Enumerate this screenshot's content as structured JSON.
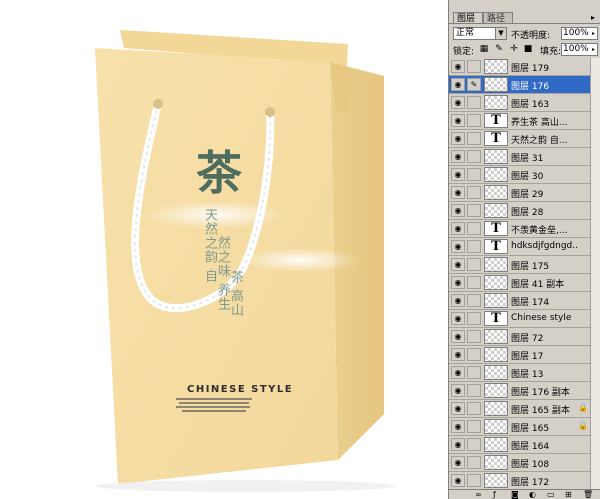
{
  "canvas": {
    "bag_main_character": "茶",
    "bag_vertical_texts": [
      "天然之韵 自",
      "然之味 养生",
      "茶 高山"
    ],
    "brand_text": "CHINESE STYLE"
  },
  "panel": {
    "tabs": [
      {
        "label": "图层",
        "active": true
      },
      {
        "label": "路径",
        "active": false
      }
    ],
    "menu_arrow": "▸",
    "blend_mode": "正常",
    "opacity_label": "不透明度:",
    "opacity_value": "100%",
    "lock_label": "锁定:",
    "fill_label": "填充:",
    "fill_value": "100%",
    "layers": [
      {
        "name": "图层 179",
        "type": "raster",
        "selected": false,
        "locked": false
      },
      {
        "name": "图层 176",
        "type": "raster",
        "selected": true,
        "locked": false
      },
      {
        "name": "图层 163",
        "type": "raster",
        "selected": false,
        "locked": false
      },
      {
        "name": "养生茶 高山...",
        "type": "text",
        "selected": false,
        "locked": false
      },
      {
        "name": "天然之韵 自...",
        "type": "text",
        "selected": false,
        "locked": false
      },
      {
        "name": "图层 31",
        "type": "raster",
        "selected": false,
        "locked": false
      },
      {
        "name": "图层 30",
        "type": "raster",
        "selected": false,
        "locked": false
      },
      {
        "name": "图层 29",
        "type": "raster",
        "selected": false,
        "locked": false
      },
      {
        "name": "图层 28",
        "type": "raster",
        "selected": false,
        "locked": false
      },
      {
        "name": "不羡黄金垒,...",
        "type": "text",
        "selected": false,
        "locked": false
      },
      {
        "name": "hdksdjfgdngd...",
        "type": "text",
        "selected": false,
        "locked": false
      },
      {
        "name": "图层 175",
        "type": "raster",
        "selected": false,
        "locked": false
      },
      {
        "name": "图层 41 副本",
        "type": "raster",
        "selected": false,
        "locked": false
      },
      {
        "name": "图层 174",
        "type": "raster",
        "selected": false,
        "locked": false
      },
      {
        "name": "Chinese style",
        "type": "text",
        "selected": false,
        "locked": false
      },
      {
        "name": "图层 72",
        "type": "raster",
        "selected": false,
        "locked": false
      },
      {
        "name": "图层 17",
        "type": "raster",
        "selected": false,
        "locked": false
      },
      {
        "name": "图层 13",
        "type": "raster",
        "selected": false,
        "locked": false
      },
      {
        "name": "图层 176 副本",
        "type": "raster",
        "selected": false,
        "locked": false
      },
      {
        "name": "图层 165 副本",
        "type": "raster",
        "selected": false,
        "locked": true
      },
      {
        "name": "图层 165",
        "type": "raster",
        "selected": false,
        "locked": true
      },
      {
        "name": "图层 164",
        "type": "raster",
        "selected": false,
        "locked": false
      },
      {
        "name": "图层 108",
        "type": "raster",
        "selected": false,
        "locked": false
      },
      {
        "name": "图层 172",
        "type": "raster",
        "selected": false,
        "locked": false
      }
    ],
    "text_thumb_glyph": "T",
    "eye_glyph": "👁",
    "brush_glyph": "✎",
    "lock_glyph": "🔒",
    "colors": {
      "panel_bg": "#d4d0c8",
      "selection": "#316ac5",
      "bag": "#f6dfa6"
    }
  }
}
